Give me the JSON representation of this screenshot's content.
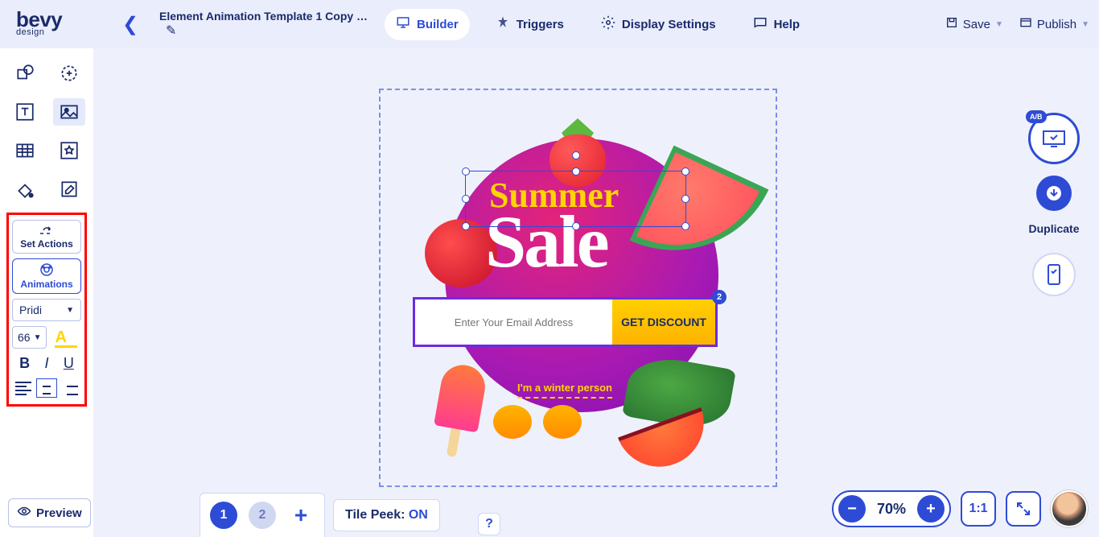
{
  "logo": {
    "main": "bevy",
    "sub": "design"
  },
  "document": {
    "title": "Element Animation Template 1 Copy Cop..."
  },
  "nav": {
    "builder": "Builder",
    "triggers": "Triggers",
    "display_settings": "Display Settings",
    "help": "Help"
  },
  "top_actions": {
    "save": "Save",
    "publish": "Publish"
  },
  "left_panel": {
    "set_actions": "Set Actions",
    "animations": "Animations",
    "font_family": "Pridi",
    "font_size": "66",
    "bold": "B",
    "italic": "I",
    "underline": "U"
  },
  "preview": "Preview",
  "canvas": {
    "summer": "Summer",
    "sale": "Sale",
    "email_placeholder": "Enter Your Email Address",
    "discount_btn": "GET DISCOUNT",
    "badge": "2",
    "winter": "I'm a winter person"
  },
  "right": {
    "ab": "A/B",
    "duplicate": "Duplicate"
  },
  "bottom": {
    "page1": "1",
    "page2": "2",
    "tile_peek_label": "Tile Peek: ",
    "tile_peek_state": "ON",
    "help": "?",
    "zoom": "70%",
    "fit": "1:1"
  }
}
